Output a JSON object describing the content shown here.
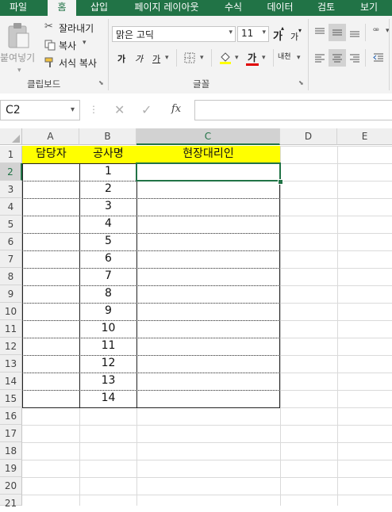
{
  "ribbon_tabs": [
    "파일",
    "홈",
    "삽입",
    "페이지 레이아웃",
    "수식",
    "데이터",
    "검토",
    "보기"
  ],
  "active_tab": "홈",
  "clipboard": {
    "paste_label": "붙여넣기",
    "cut_label": "잘라내기",
    "copy_label": "복사",
    "format_painter_label": "서식 복사",
    "group_label": "클립보드"
  },
  "font": {
    "name": "맑은 고딕",
    "size": "11",
    "grow_label": "가",
    "shrink_label": "가",
    "bold_label": "가",
    "italic_label": "가",
    "underline_label": "가",
    "phonetic_label": "내천",
    "group_label": "글꼴"
  },
  "name_box": "C2",
  "formula_fx": "fx",
  "formula_value": "",
  "columns": [
    "A",
    "B",
    "C",
    "D",
    "E"
  ],
  "selected_column": "C",
  "rows": [
    "1",
    "2",
    "3",
    "4",
    "5",
    "6",
    "7",
    "8",
    "9",
    "10",
    "11",
    "12",
    "13",
    "14",
    "15",
    "16",
    "17",
    "18",
    "19",
    "20",
    "21"
  ],
  "selected_row": "2",
  "header_row": [
    "담당자",
    "공사명",
    "현장대리인"
  ],
  "b_values": [
    "1",
    "2",
    "3",
    "4",
    "5",
    "6",
    "7",
    "8",
    "9",
    "10",
    "11",
    "12",
    "13",
    "14"
  ],
  "colors": {
    "brand": "#217346",
    "header_fill": "#ffff00",
    "font_color_bar": "#e00000",
    "fill_color_bar": "#ffff00"
  }
}
